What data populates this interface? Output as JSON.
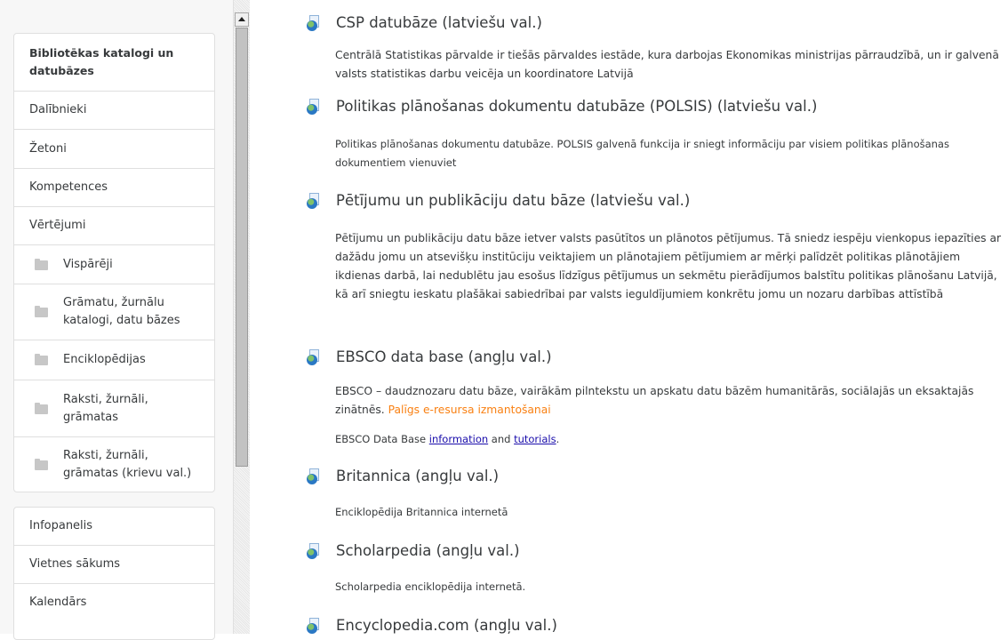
{
  "sidebar": {
    "card1": {
      "title": "Bibliotēkas katalogi un datubāzes",
      "items": [
        {
          "label": "Dalībnieki"
        },
        {
          "label": "Žetoni"
        },
        {
          "label": "Kompetences"
        },
        {
          "label": "Vērtējumi"
        }
      ],
      "folders": [
        {
          "label": "Vispārēji"
        },
        {
          "label": "Grāmatu, žurnālu katalogi, datu bāzes"
        },
        {
          "label": "Enciklopēdijas"
        },
        {
          "label": "Raksti, žurnāli, grāmatas"
        },
        {
          "label": "Raksti, žurnāli, grāmatas (krievu val.)"
        }
      ]
    },
    "card2": {
      "items": [
        {
          "label": "Infopanelis"
        },
        {
          "label": "Vietnes sākums"
        },
        {
          "label": "Kalendārs"
        }
      ]
    }
  },
  "main": {
    "entries": [
      {
        "title": "CSP datubāze (latviešu val.)",
        "desc": "Centrālā Statistikas pārvalde ir tiešās pārvaldes iestāde, kura darbojas Ekonomikas ministrijas pārraudzībā, un ir galvenā valsts statistikas darbu veicēja un koordinatore Latvijā"
      },
      {
        "title": "Politikas plānošanas dokumentu datubāze (POLSIS) (latviešu val.)",
        "desc": "Politikas plānošanas dokumentu datubāze. POLSIS galvenā funkcija ir sniegt informāciju par visiem politikas plānošanas dokumentiem vienuviet"
      },
      {
        "title": "Pētījumu un publikāciju datu bāze (latviešu val.)",
        "desc": "Pētījumu un publikāciju datu bāze ietver valsts pasūtītos un plānotos pētījumus. Tā sniedz iespēju vienkopus iepazīties ar dažādu jomu un atsevišķu institūciju veiktajiem un plānotajiem pētījumiem ar mērķi palīdzēt politikas plānotājiem ikdienas darbā, lai nedublētu jau esošus līdzīgus pētījumus un sekmētu pierādījumos balstītu politikas plānošanu Latvijā, kā arī sniegtu ieskatu plašākai sabiedrībai par valsts ieguldījumiem konkrētu jomu un nozaru darbības attīstībā"
      },
      {
        "title": "EBSCO data base (angļu val.)",
        "desc": "EBSCO – daudznozaru datu bāze, vairākām pilntekstu un apskatu datu bāzēm humanitārās, sociālajās un eksaktajās zinātnēs.",
        "link": "Palīgs e-resursa izmantošanai",
        "extra_prefix": "EBSCO Data Base ",
        "extra_link1": "information",
        "extra_mid": " and ",
        "extra_link2": "tutorials",
        "extra_suffix": "."
      },
      {
        "title": "Britannica (angļu val.)",
        "desc": "Enciklopēdija Britannica internetā"
      },
      {
        "title": "Scholarpedia (angļu val.)",
        "desc": "Scholarpedia enciklopēdija internetā."
      },
      {
        "title": "Encyclopedia.com (angļu val.)"
      }
    ]
  }
}
